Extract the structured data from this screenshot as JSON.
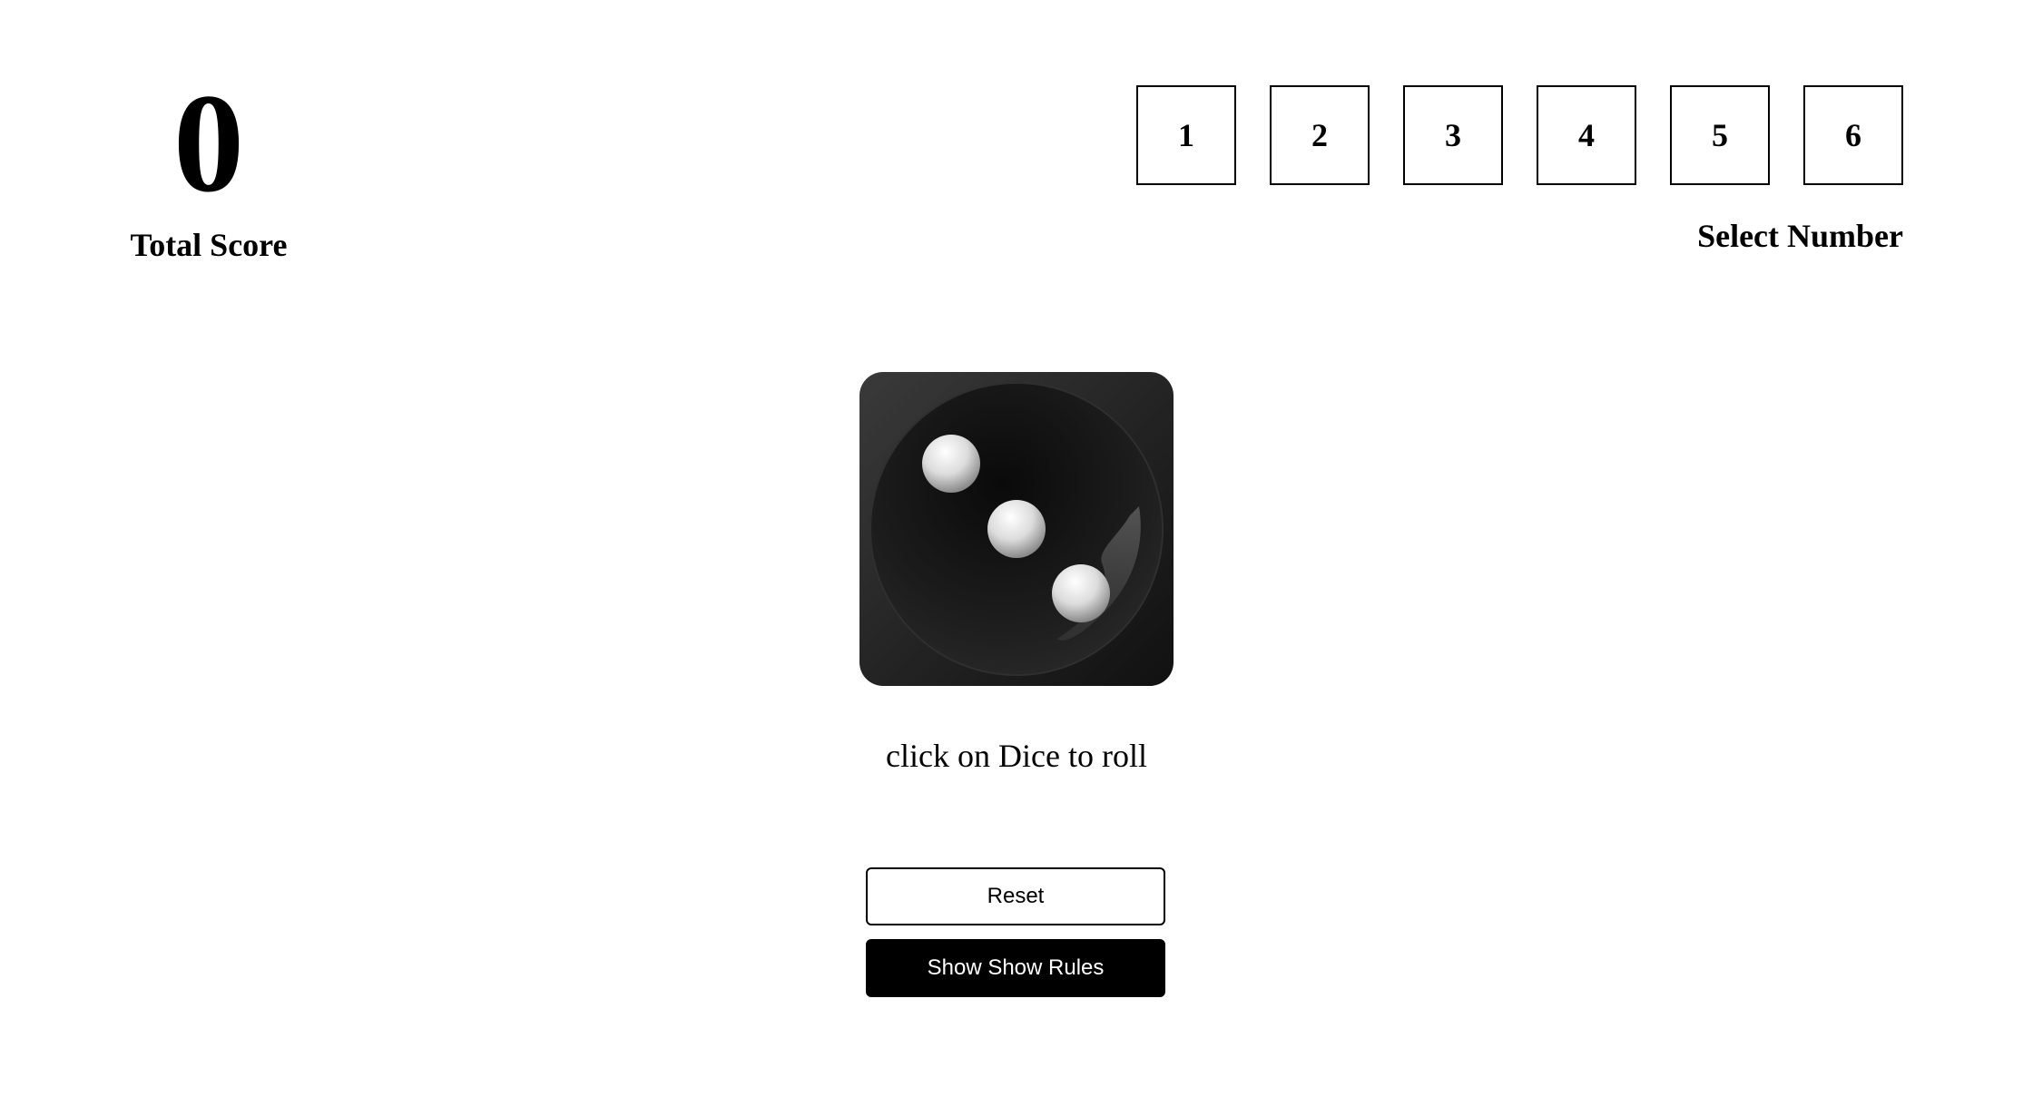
{
  "score": {
    "value": "0",
    "label": "Total Score"
  },
  "selector": {
    "numbers": [
      "1",
      "2",
      "3",
      "4",
      "5",
      "6"
    ],
    "label": "Select Number"
  },
  "dice": {
    "face_value": 3,
    "icon": "dice-three-icon"
  },
  "roll_hint": "click on Dice to roll",
  "buttons": {
    "reset_label": "Reset",
    "rules_label": "Show Show Rules"
  }
}
